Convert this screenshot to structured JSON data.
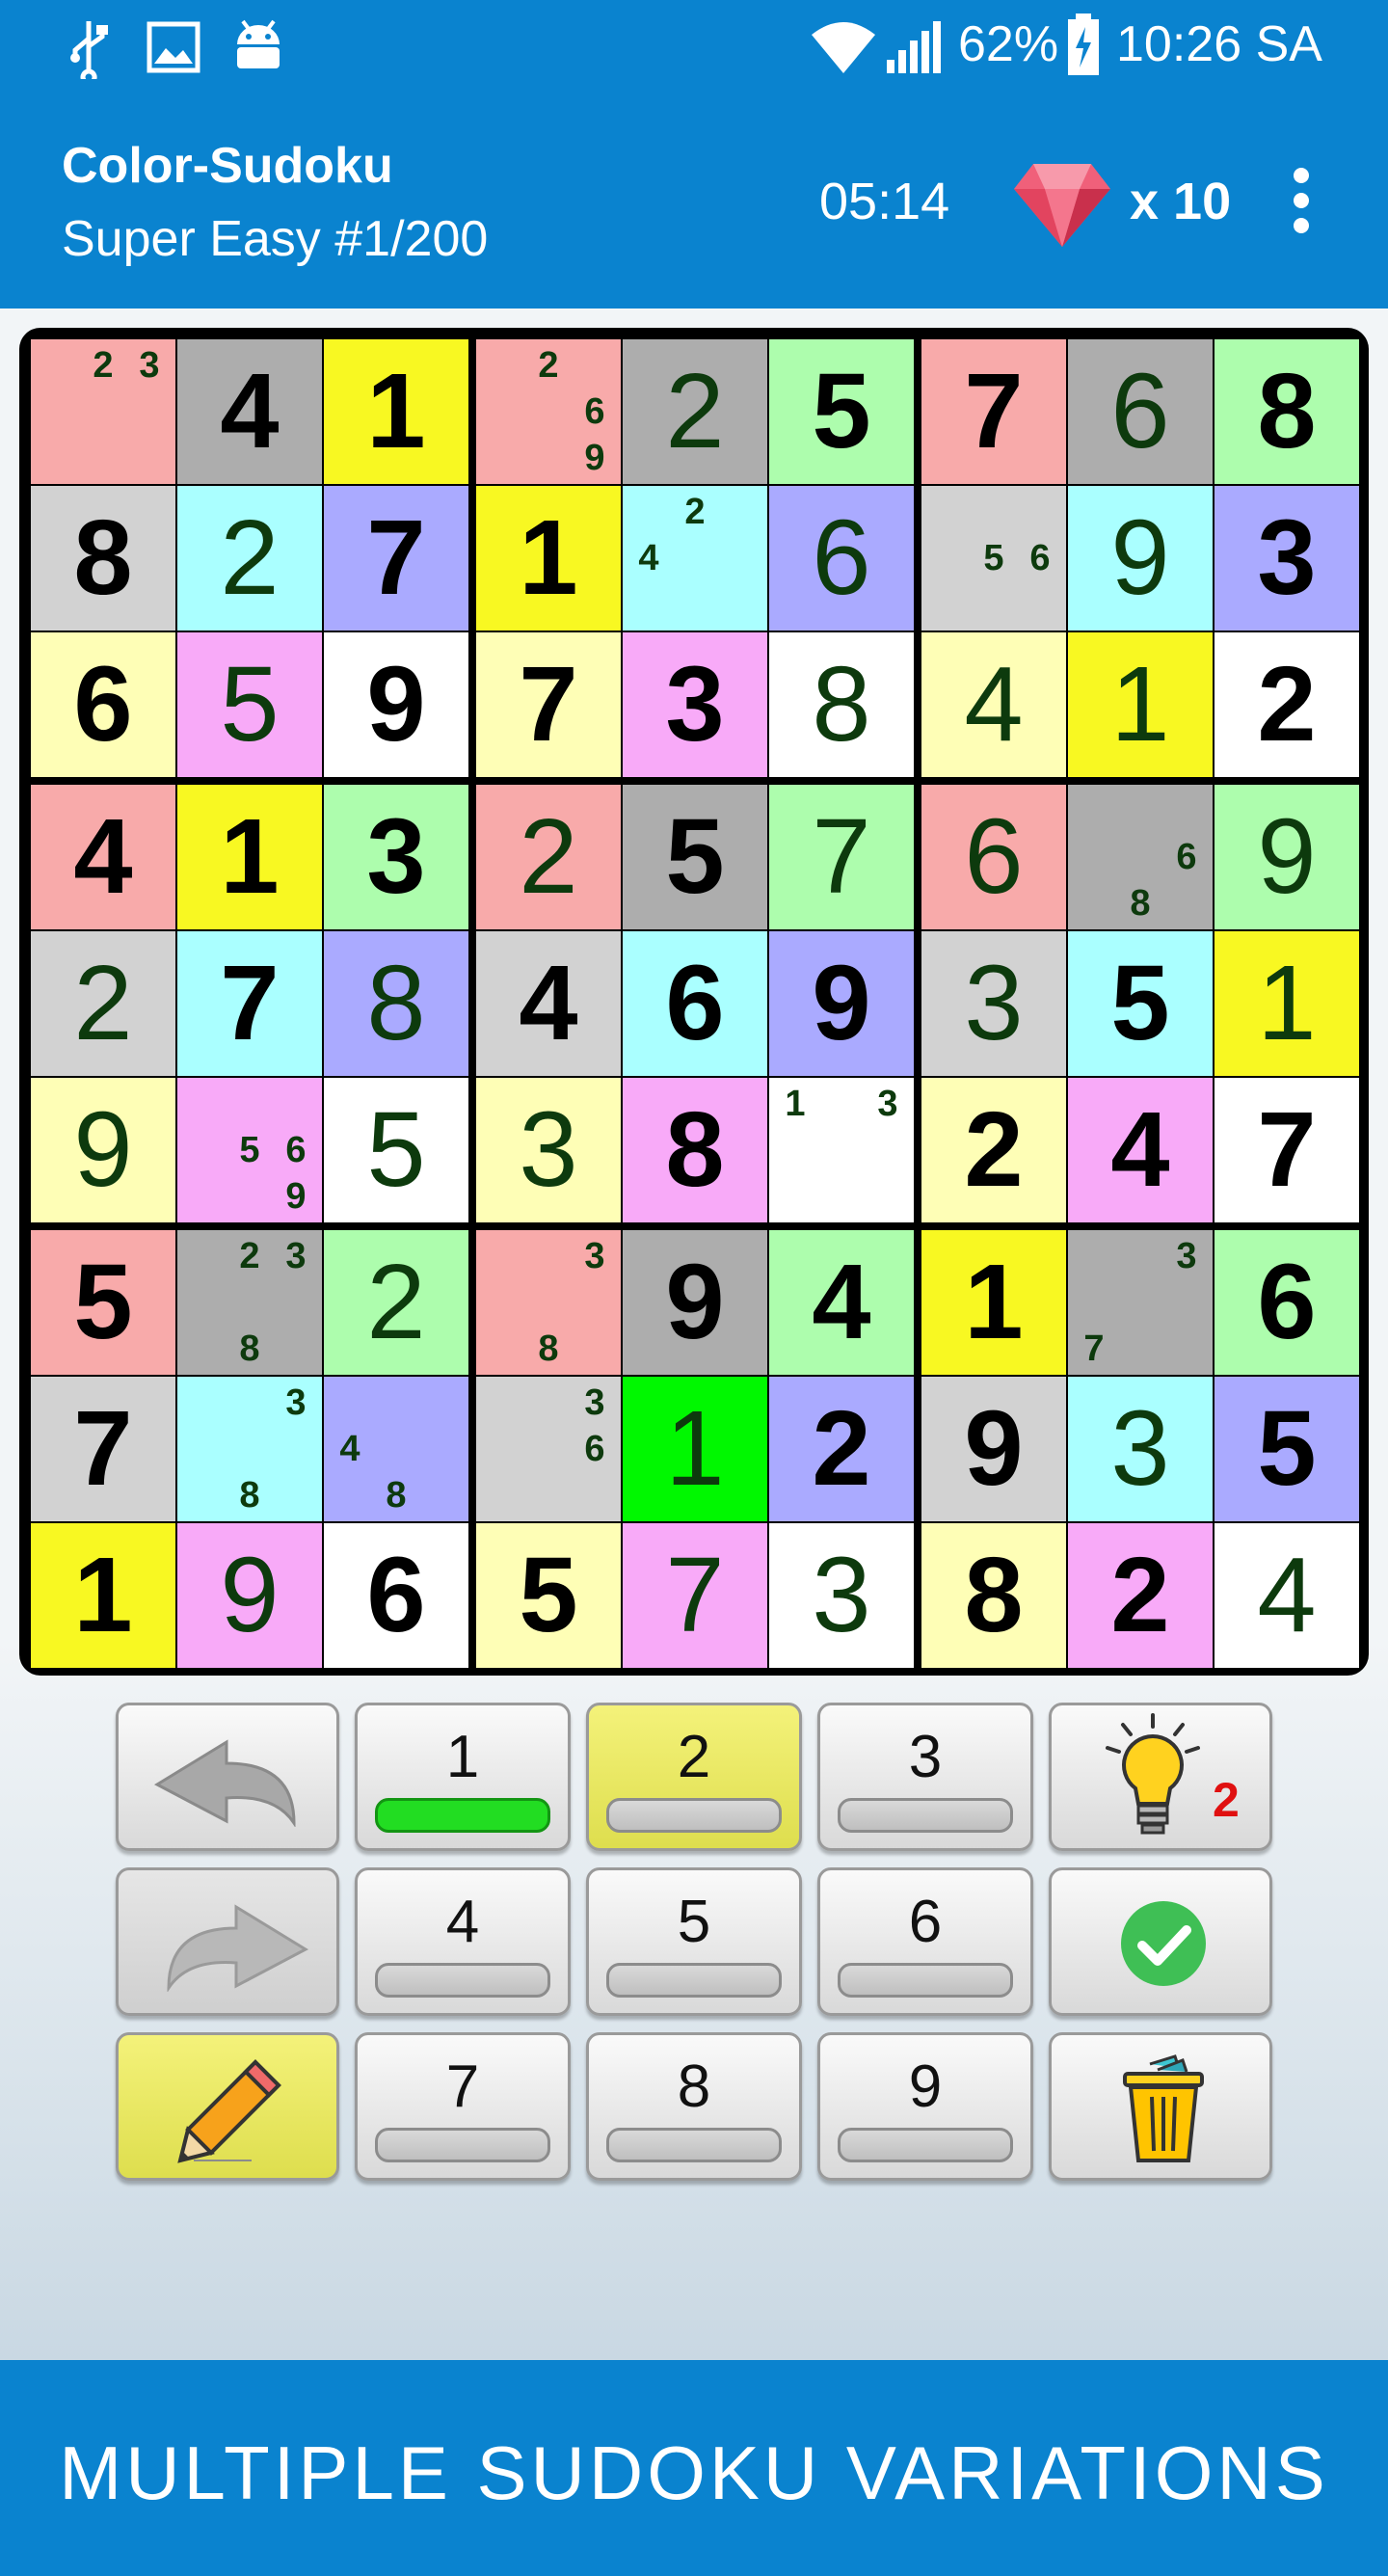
{
  "status_bar": {
    "battery": "62%",
    "time": "10:26 SA",
    "icons": [
      "usb-icon",
      "image-icon",
      "android-icon",
      "wifi-icon",
      "signal-icon",
      "battery-charging-icon"
    ]
  },
  "app_bar": {
    "title": "Color-Sudoku",
    "subtitle": "Super Easy  #1/200",
    "timer": "05:14",
    "gems": "x 10",
    "gem_icon": "ruby-gem-icon",
    "menu_icon": "more-vert-icon"
  },
  "board": {
    "colors": {
      "R": "#f8aaaa",
      "G": "#adadad",
      "Y": "#f8f822",
      "L": "#fefeb6",
      "C": "#aaffff",
      "B": "#aaaaff",
      "P": "#f8aaf8",
      "W": "#ffffff",
      "S": "#d2d2d2",
      "N": "#adfdad",
      "X": "#00f800"
    },
    "cells": [
      [
        {
          "c": "R",
          "v": "",
          "n": [
            "2",
            "3"
          ]
        },
        {
          "c": "G",
          "v": "4",
          "k": "g"
        },
        {
          "c": "Y",
          "v": "1",
          "k": "g"
        },
        {
          "c": "R",
          "v": "",
          "n": [
            "2",
            "6",
            "9"
          ]
        },
        {
          "c": "G",
          "v": "2",
          "k": "u"
        },
        {
          "c": "N",
          "v": "5",
          "k": "g"
        },
        {
          "c": "R",
          "v": "7",
          "k": "g"
        },
        {
          "c": "G",
          "v": "6",
          "k": "u"
        },
        {
          "c": "N",
          "v": "8",
          "k": "g"
        }
      ],
      [
        {
          "c": "S",
          "v": "8",
          "k": "g"
        },
        {
          "c": "C",
          "v": "2",
          "k": "u"
        },
        {
          "c": "B",
          "v": "7",
          "k": "g"
        },
        {
          "c": "Y",
          "v": "1",
          "k": "g"
        },
        {
          "c": "C",
          "v": "",
          "n": [
            "2",
            "4"
          ]
        },
        {
          "c": "B",
          "v": "6",
          "k": "u"
        },
        {
          "c": "S",
          "v": "",
          "n": [
            "5",
            "6"
          ]
        },
        {
          "c": "C",
          "v": "9",
          "k": "u"
        },
        {
          "c": "B",
          "v": "3",
          "k": "g"
        }
      ],
      [
        {
          "c": "L",
          "v": "6",
          "k": "g"
        },
        {
          "c": "P",
          "v": "5",
          "k": "u"
        },
        {
          "c": "W",
          "v": "9",
          "k": "g"
        },
        {
          "c": "L",
          "v": "7",
          "k": "g"
        },
        {
          "c": "P",
          "v": "3",
          "k": "g"
        },
        {
          "c": "W",
          "v": "8",
          "k": "u"
        },
        {
          "c": "L",
          "v": "4",
          "k": "u"
        },
        {
          "c": "Y",
          "v": "1",
          "k": "u"
        },
        {
          "c": "W",
          "v": "2",
          "k": "g"
        }
      ],
      [
        {
          "c": "R",
          "v": "4",
          "k": "g"
        },
        {
          "c": "Y",
          "v": "1",
          "k": "g"
        },
        {
          "c": "N",
          "v": "3",
          "k": "g"
        },
        {
          "c": "R",
          "v": "2",
          "k": "u"
        },
        {
          "c": "G",
          "v": "5",
          "k": "g"
        },
        {
          "c": "N",
          "v": "7",
          "k": "u"
        },
        {
          "c": "R",
          "v": "6",
          "k": "u"
        },
        {
          "c": "G",
          "v": "",
          "n": [
            "6",
            "8"
          ]
        },
        {
          "c": "N",
          "v": "9",
          "k": "u"
        }
      ],
      [
        {
          "c": "S",
          "v": "2",
          "k": "u"
        },
        {
          "c": "C",
          "v": "7",
          "k": "g"
        },
        {
          "c": "B",
          "v": "8",
          "k": "u"
        },
        {
          "c": "S",
          "v": "4",
          "k": "g"
        },
        {
          "c": "C",
          "v": "6",
          "k": "g"
        },
        {
          "c": "B",
          "v": "9",
          "k": "g"
        },
        {
          "c": "S",
          "v": "3",
          "k": "u"
        },
        {
          "c": "C",
          "v": "5",
          "k": "g"
        },
        {
          "c": "Y",
          "v": "1",
          "k": "u"
        }
      ],
      [
        {
          "c": "L",
          "v": "9",
          "k": "u"
        },
        {
          "c": "P",
          "v": "",
          "n": [
            "5",
            "6",
            "9"
          ]
        },
        {
          "c": "W",
          "v": "5",
          "k": "u"
        },
        {
          "c": "L",
          "v": "3",
          "k": "u"
        },
        {
          "c": "P",
          "v": "8",
          "k": "g"
        },
        {
          "c": "W",
          "v": "",
          "n": [
            "1",
            "3"
          ]
        },
        {
          "c": "L",
          "v": "2",
          "k": "g"
        },
        {
          "c": "P",
          "v": "4",
          "k": "g"
        },
        {
          "c": "W",
          "v": "7",
          "k": "g"
        }
      ],
      [
        {
          "c": "R",
          "v": "5",
          "k": "g"
        },
        {
          "c": "G",
          "v": "",
          "n": [
            "2",
            "3",
            "8"
          ]
        },
        {
          "c": "N",
          "v": "2",
          "k": "u"
        },
        {
          "c": "R",
          "v": "",
          "n": [
            "3",
            "8"
          ]
        },
        {
          "c": "G",
          "v": "9",
          "k": "g"
        },
        {
          "c": "N",
          "v": "4",
          "k": "g"
        },
        {
          "c": "Y",
          "v": "1",
          "k": "g"
        },
        {
          "c": "G",
          "v": "",
          "n": [
            "3",
            "7"
          ]
        },
        {
          "c": "N",
          "v": "6",
          "k": "g"
        }
      ],
      [
        {
          "c": "S",
          "v": "7",
          "k": "g"
        },
        {
          "c": "C",
          "v": "",
          "n": [
            "3",
            "8"
          ]
        },
        {
          "c": "B",
          "v": "",
          "n": [
            "4",
            "8"
          ]
        },
        {
          "c": "S",
          "v": "",
          "n": [
            "3",
            "6"
          ]
        },
        {
          "c": "X",
          "v": "1",
          "k": "u"
        },
        {
          "c": "B",
          "v": "2",
          "k": "g"
        },
        {
          "c": "S",
          "v": "9",
          "k": "g"
        },
        {
          "c": "C",
          "v": "3",
          "k": "u"
        },
        {
          "c": "B",
          "v": "5",
          "k": "g"
        }
      ],
      [
        {
          "c": "Y",
          "v": "1",
          "k": "g"
        },
        {
          "c": "P",
          "v": "9",
          "k": "u"
        },
        {
          "c": "W",
          "v": "6",
          "k": "g"
        },
        {
          "c": "L",
          "v": "5",
          "k": "g"
        },
        {
          "c": "P",
          "v": "7",
          "k": "u"
        },
        {
          "c": "W",
          "v": "3",
          "k": "u"
        },
        {
          "c": "L",
          "v": "8",
          "k": "g"
        },
        {
          "c": "P",
          "v": "2",
          "k": "g"
        },
        {
          "c": "W",
          "v": "4",
          "k": "u"
        }
      ]
    ]
  },
  "keypad": {
    "undo_icon": "undo-arrow-icon",
    "redo_icon": "redo-arrow-icon",
    "pencil_icon": "pencil-icon",
    "hint_icon": "lightbulb-icon",
    "hint_count": "2",
    "check_icon": "check-circle-icon",
    "trash_icon": "trash-icon",
    "digits": [
      {
        "label": "1",
        "progress": 1.0
      },
      {
        "label": "2",
        "progress": 0
      },
      {
        "label": "3",
        "progress": 0
      },
      {
        "label": "4",
        "progress": 0
      },
      {
        "label": "5",
        "progress": 0
      },
      {
        "label": "6",
        "progress": 0
      },
      {
        "label": "7",
        "progress": 0
      },
      {
        "label": "8",
        "progress": 0
      },
      {
        "label": "9",
        "progress": 0
      }
    ],
    "selected_digit": "2"
  },
  "banner": {
    "text": "MULTIPLE SUDOKU VARIATIONS"
  }
}
